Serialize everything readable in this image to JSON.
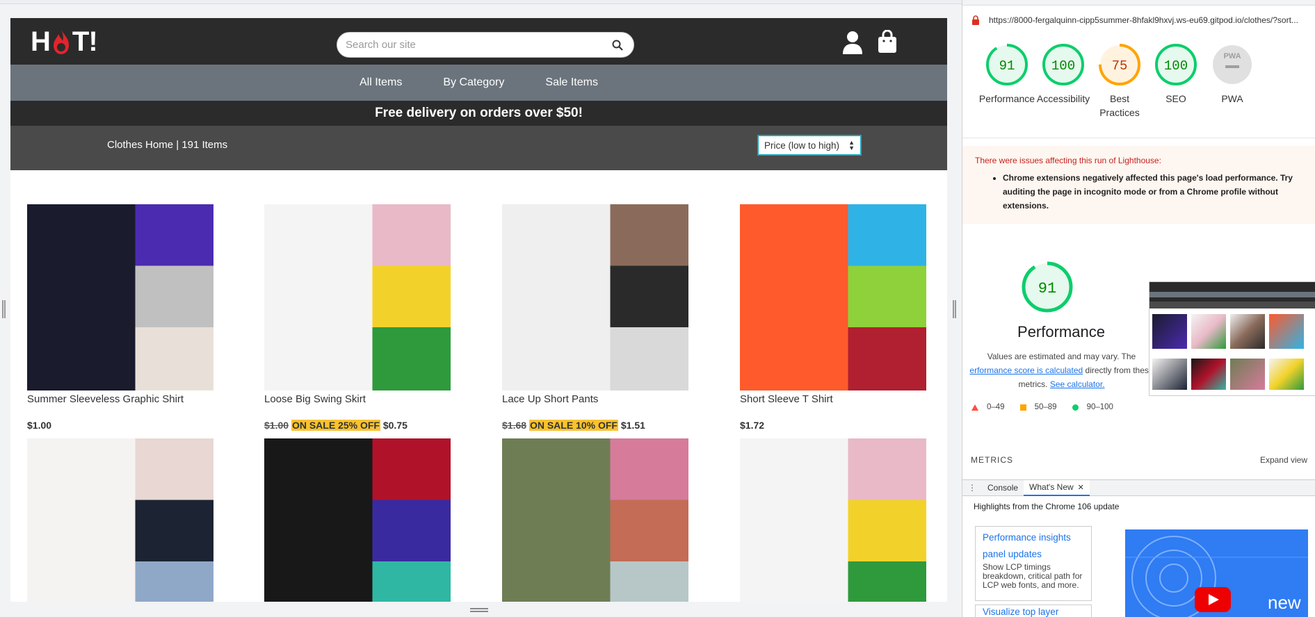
{
  "site": {
    "logo_text": "HOT!",
    "search_placeholder": "Search our site",
    "nav": [
      "All Items",
      "By Category",
      "Sale Items"
    ],
    "promo": "Free delivery on orders over $50!",
    "breadcrumb": "Clothes Home | 191 Items",
    "sort_selected": "Price (low to high)",
    "products": [
      {
        "name": "Summer Sleeveless Graphic Shirt",
        "price": "$1.00",
        "old": "",
        "sale": "",
        "palette": [
          "#1b1b2e",
          "#4b2bb0",
          "#c0c0c0",
          "#e8e0d8"
        ]
      },
      {
        "name": "Loose Big Swing Skirt",
        "price": "$0.75",
        "old": "$1.00",
        "sale": "ON SALE 25% OFF",
        "palette": [
          "#f4f4f4",
          "#e9b9c7",
          "#f2d22a",
          "#2e9a3c"
        ]
      },
      {
        "name": "Lace Up Short Pants",
        "price": "$1.51",
        "old": "$1.68",
        "sale": "ON SALE 10% OFF",
        "palette": [
          "#efefef",
          "#8a6b5b",
          "#2a2a2a",
          "#d9d9d9"
        ]
      },
      {
        "name": "Short Sleeve T Shirt",
        "price": "$1.72",
        "old": "",
        "sale": "",
        "palette": [
          "#ff5a2c",
          "#2fb3e6",
          "#8ed13a",
          "#b02030"
        ]
      },
      {
        "name": "",
        "price": "",
        "old": "",
        "sale": "",
        "palette": [
          "#f5f3f1",
          "#e8d7d3",
          "#1c2333",
          "#8fa8c8"
        ]
      },
      {
        "name": "",
        "price": "",
        "old": "",
        "sale": "",
        "palette": [
          "#181818",
          "#b0122a",
          "#3a2aa0",
          "#30b7a4"
        ]
      },
      {
        "name": "",
        "price": "",
        "old": "",
        "sale": "",
        "palette": [
          "#6f7d55",
          "#d67b9a",
          "#c46c56",
          "#b7c7c7"
        ]
      },
      {
        "name": "",
        "price": "",
        "old": "",
        "sale": "",
        "palette": [
          "#f4f4f4",
          "#e9b9c7",
          "#f2d22a",
          "#2e9a3c"
        ]
      }
    ]
  },
  "devtools": {
    "url": "https://8000-fergalquinn-cipp5summer-8hfakl9hxvj.ws-eu69.gitpod.io/clothes/?sort...",
    "scores": [
      {
        "label": "Performance",
        "value": "91",
        "color": "#0cce6b",
        "bg": "#e6f9ee",
        "fraction": 0.91
      },
      {
        "label": "Accessibility",
        "value": "100",
        "color": "#0cce6b",
        "bg": "#e6f9ee",
        "fraction": 1.0
      },
      {
        "label": "Best Practices",
        "value": "75",
        "color": "#ffa400",
        "bg": "#fff3e0",
        "fraction": 0.75
      },
      {
        "label": "SEO",
        "value": "100",
        "color": "#0cce6b",
        "bg": "#e6f9ee",
        "fraction": 1.0
      },
      {
        "label": "PWA",
        "value": "",
        "color": "#bdbdbd",
        "bg": "#e0e0e0",
        "fraction": 0
      }
    ],
    "warning_head": "There were issues affecting this run of Lighthouse:",
    "warning_item": "Chrome extensions negatively affected this page's load performance. Try auditing the page in incognito mode or from a Chrome profile without extensions.",
    "perf_score": "91",
    "perf_title": "Performance",
    "perf_desc_1": "Values are estimated and may vary. The",
    "perf_desc_link": "erformance score is calculated",
    "perf_desc_2": "directly from these",
    "perf_desc_3": "metrics.",
    "perf_desc_calc": "See calculator.",
    "legend": [
      "0–49",
      "50–89",
      "90–100"
    ],
    "metrics_label": "METRICS",
    "expand_label": "Expand view",
    "tabs": [
      "Console",
      "What's New"
    ],
    "whatsnew_head": "Highlights from the Chrome 106 update",
    "card1_title": "Performance insights panel updates",
    "card1_desc": "Show LCP timings breakdown, critical path for LCP web fonts, and more.",
    "card2_title": "Visualize top layer",
    "video_text": "new"
  }
}
